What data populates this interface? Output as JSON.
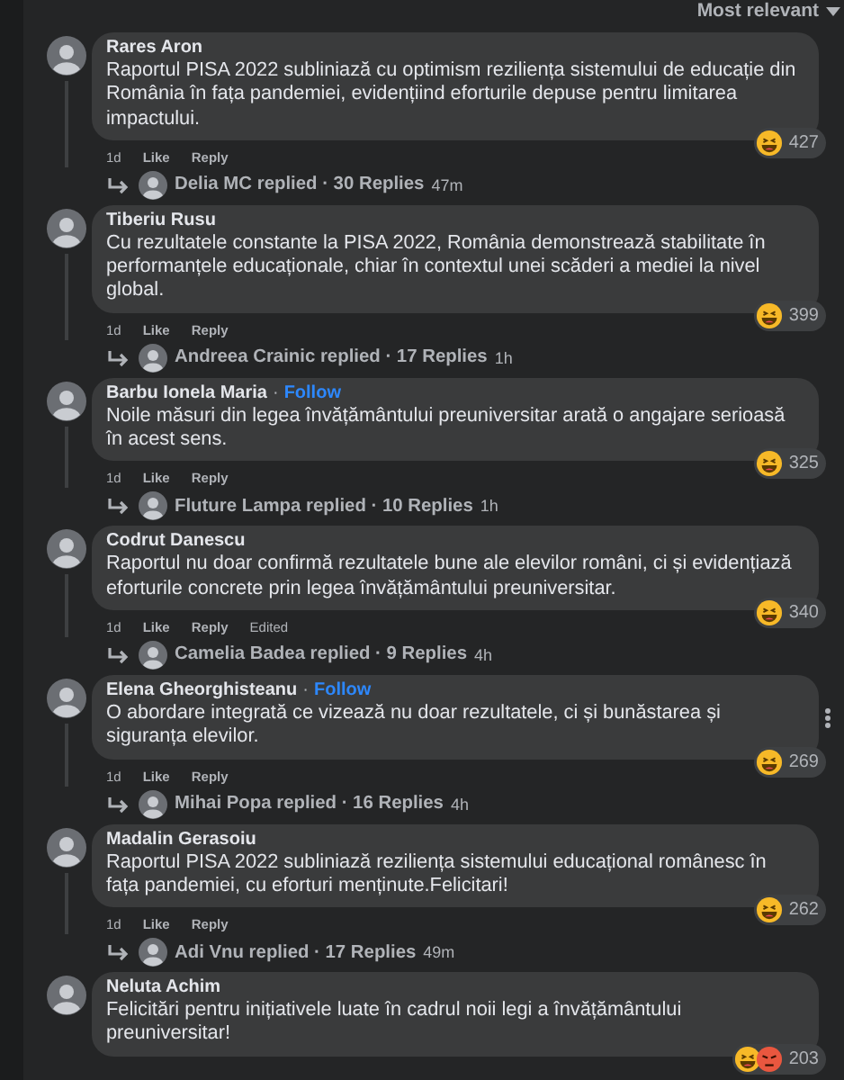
{
  "sort": {
    "label": "Most relevant"
  },
  "comments": [
    {
      "author": "Rares Aron",
      "text": "Raportul PISA 2022 subliniază cu optimism reziliența sistemului de educație din România în fața pandemiei, evidențiind eforturile depuse pentru limitarea impactului.",
      "reactions": [
        {
          "kind": "haha"
        }
      ],
      "reaction_count": "427",
      "time": "1d",
      "like": "Like",
      "reply": "Reply",
      "replies": {
        "summary": "Delia MC replied · 30 Replies",
        "time": "47m"
      }
    },
    {
      "author": "Tiberiu Rusu",
      "text": "Cu rezultatele constante la PISA 2022, România demonstrează stabilitate în performanțele educaționale, chiar în contextul unei scăderi a mediei la nivel global.",
      "reactions": [
        {
          "kind": "haha"
        }
      ],
      "reaction_count": "399",
      "time": "1d",
      "like": "Like",
      "reply": "Reply",
      "replies": {
        "summary": "Andreea Crainic replied · 17 Replies",
        "time": "1h"
      }
    },
    {
      "author": "Barbu Ionela Maria",
      "follow": {
        "separator": "·",
        "label": "Follow"
      },
      "text": "Noile măsuri din legea învățământului preuniversitar arată o angajare serioasă în acest sens.",
      "reactions": [
        {
          "kind": "haha"
        }
      ],
      "reaction_count": "325",
      "time": "1d",
      "like": "Like",
      "reply": "Reply",
      "replies": {
        "summary": "Fluture Lampa replied · 10 Replies",
        "time": "1h"
      }
    },
    {
      "author": "Codrut Danescu",
      "text": "Raportul nu doar confirmă rezultatele bune ale elevilor români, ci și evidențiază eforturile concrete prin legea învățământului preuniversitar.",
      "reactions": [
        {
          "kind": "haha"
        }
      ],
      "reaction_count": "340",
      "time": "1d",
      "like": "Like",
      "reply": "Reply",
      "edited": "Edited",
      "replies": {
        "summary": "Camelia Badea replied · 9 Replies",
        "time": "4h"
      }
    },
    {
      "author": "Elena Gheorghisteanu",
      "follow": {
        "separator": "·",
        "label": "Follow"
      },
      "menu_shown": true,
      "text": "O abordare integrată ce vizează nu doar rezultatele, ci și bunăstarea și siguranța elevilor.",
      "reactions": [
        {
          "kind": "haha"
        }
      ],
      "reaction_count": "269",
      "time": "1d",
      "like": "Like",
      "reply": "Reply",
      "replies": {
        "summary": "Mihai Popa replied · 16 Replies",
        "time": "4h"
      }
    },
    {
      "author": "Madalin Gerasoiu",
      "text": "Raportul PISA 2022 subliniază reziliența sistemului educațional românesc în fața pandemiei, cu eforturi menținute.Felicitari!",
      "reactions": [
        {
          "kind": "haha"
        }
      ],
      "reaction_count": "262",
      "time": "1d",
      "like": "Like",
      "reply": "Reply",
      "replies": {
        "summary": "Adi Vnu replied · 17 Replies",
        "time": "49m"
      }
    },
    {
      "author": "Neluta Achim",
      "text": "Felicitări pentru inițiativele luate în cadrul noii legi a învățământului preuniversitar!",
      "reactions": [
        {
          "kind": "haha"
        },
        {
          "kind": "angry"
        }
      ],
      "reaction_count": "203"
    }
  ]
}
